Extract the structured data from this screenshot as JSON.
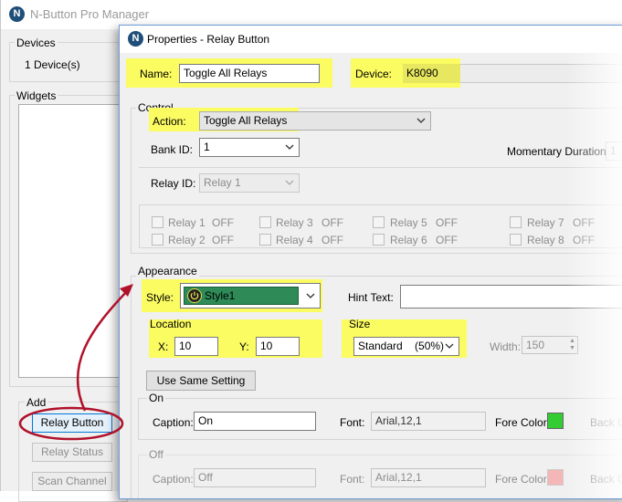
{
  "main_window": {
    "title": "N-Button Pro Manager",
    "devices": {
      "label": "Devices",
      "count_text": "1 Device(s)"
    },
    "widgets": {
      "label": "Widgets"
    },
    "add": {
      "label": "Add",
      "relay_button": "Relay Button",
      "relay_status": "Relay Status",
      "scan_channel": "Scan Channel"
    }
  },
  "dialog": {
    "title": "Properties - Relay Button",
    "name_label": "Name:",
    "name_value": "Toggle All Relays",
    "device_label": "Device:",
    "device_value": "K8090",
    "control": {
      "label": "Control",
      "action_label": "Action:",
      "action_value": "Toggle All Relays",
      "bank_id_label": "Bank ID:",
      "bank_id_value": "1",
      "momentary_label": "Momentary Duration:",
      "momentary_value": "1",
      "relay_id_label": "Relay ID:",
      "relay_id_value": "Relay 1",
      "relays": [
        {
          "name": "Relay 1",
          "state": "OFF"
        },
        {
          "name": "Relay 2",
          "state": "OFF"
        },
        {
          "name": "Relay 3",
          "state": "OFF"
        },
        {
          "name": "Relay 4",
          "state": "OFF"
        },
        {
          "name": "Relay 5",
          "state": "OFF"
        },
        {
          "name": "Relay 6",
          "state": "OFF"
        },
        {
          "name": "Relay 7",
          "state": "OFF"
        },
        {
          "name": "Relay 8",
          "state": "OFF"
        }
      ]
    },
    "appearance": {
      "label": "Appearance",
      "style_label": "Style:",
      "style_value": "Style1",
      "style_color": "#2e8b57",
      "hint_label": "Hint Text:",
      "hint_value": "",
      "location_label": "Location",
      "x_label": "X:",
      "x_value": "10",
      "y_label": "Y:",
      "y_value": "10",
      "size_label": "Size",
      "size_value": "Standard    (50%)",
      "width_label": "Width:",
      "width_value": "150",
      "use_same_setting": "Use Same Setting"
    },
    "on": {
      "label": "On",
      "caption_label": "Caption:",
      "caption_value": "On",
      "font_label": "Font:",
      "font_value": "Arial,12,1",
      "fore_color_label": "Fore Color:",
      "fore_color": "#33cc33",
      "back_color_label": "Back C"
    },
    "off": {
      "label": "Off",
      "caption_label": "Caption:",
      "caption_value": "Off",
      "font_label": "Font:",
      "font_value": "Arial,12,1",
      "fore_color_label": "Fore Color:",
      "fore_color": "#f4b6b6",
      "back_color_label": "Back C"
    }
  },
  "colors": {
    "highlight": "#fbfb62",
    "annotation": "#b0122b",
    "accent": "#1f4e79"
  }
}
